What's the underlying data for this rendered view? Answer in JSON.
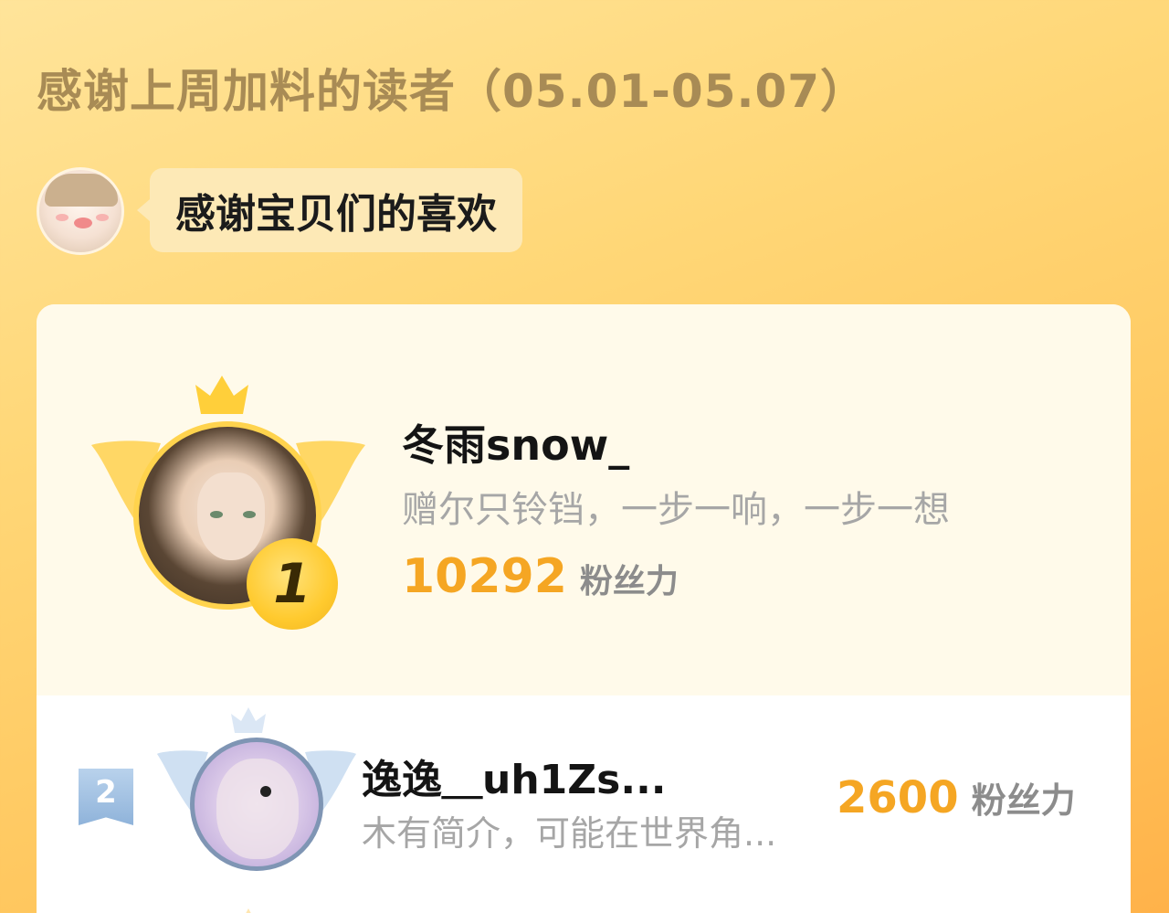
{
  "header": {
    "title": "感谢上周加料的读者（05.01-05.07）"
  },
  "greeting": {
    "avatar_icon": "baby-avatar",
    "message": "感谢宝贝们的喜欢"
  },
  "ranking": [
    {
      "rank": "1",
      "name": "冬雨snow_",
      "signature": "赠尔只铃铛，一步一响，一步一想",
      "score": "10292",
      "unit": "粉丝力",
      "badge_color": "#ffca2e",
      "frame_color": "#ffd34d"
    },
    {
      "rank": "2",
      "name": "逸逸＿uh1Zs...",
      "signature": "木有简介，可能在世界角...",
      "score": "2600",
      "unit": "粉丝力",
      "badge_color": "#8fb3da",
      "frame_color": "#7f95b4"
    }
  ],
  "colors": {
    "title": "#a88b55",
    "score": "#f5a623",
    "background_top": "#ffe49a",
    "background_bottom": "#ffb24a"
  }
}
